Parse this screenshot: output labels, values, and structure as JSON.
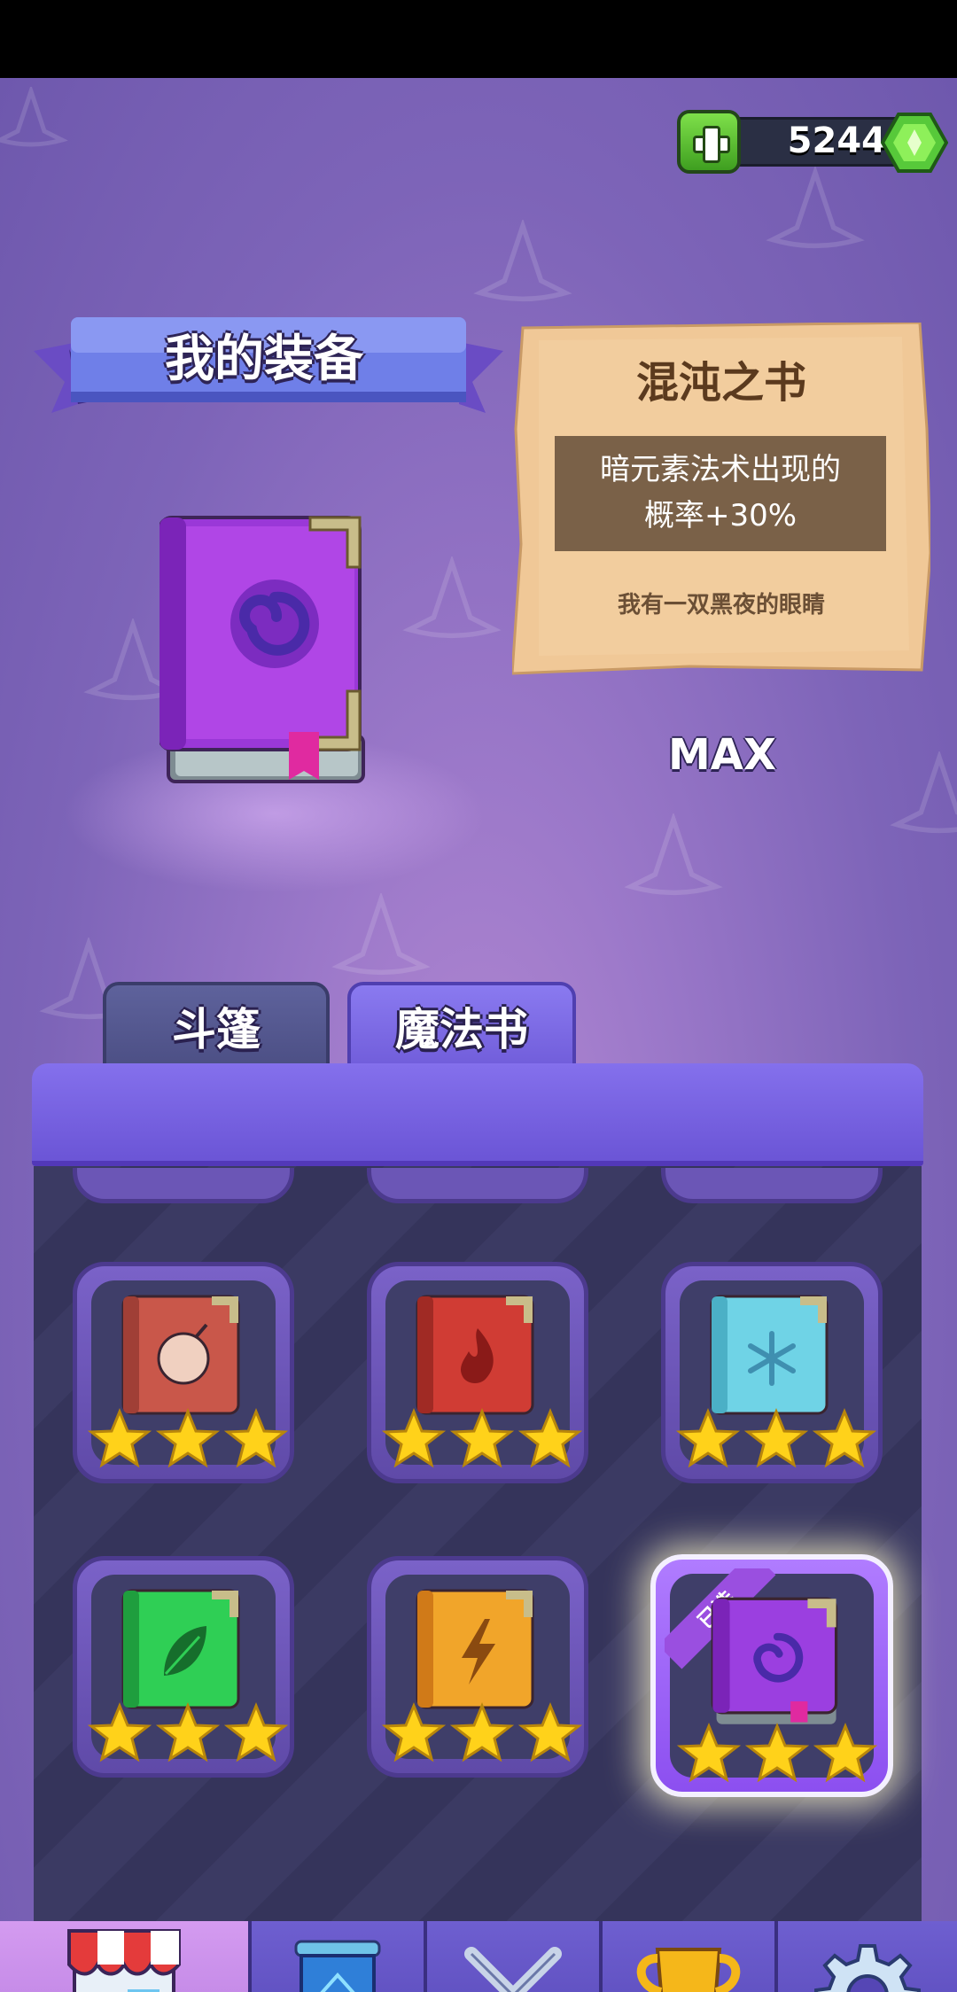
{
  "currency": {
    "amount": "5244",
    "add_icon": "plus-icon",
    "gem_icon": "green-gem-icon"
  },
  "header": {
    "title": "我的装备"
  },
  "item_detail": {
    "name": "混沌之书",
    "description_line1": "暗元素法术出现的",
    "description_line2": "概率+30%",
    "flavor": "我有一双黑夜的眼睛",
    "level_label": "MAX"
  },
  "tabs": [
    {
      "label": "斗篷",
      "active": false
    },
    {
      "label": "魔法书",
      "active": true
    }
  ],
  "books": [
    {
      "name": "bomb-book",
      "color": "#c9574a",
      "icon": "bomb-icon",
      "stars": 3,
      "selected": false
    },
    {
      "name": "fire-book",
      "color": "#d03c34",
      "icon": "flame-icon",
      "stars": 3,
      "selected": false
    },
    {
      "name": "ice-book",
      "color": "#6fd3e6",
      "icon": "snowflake-icon",
      "stars": 3,
      "selected": false
    },
    {
      "name": "nature-book",
      "color": "#2fcf55",
      "icon": "leaf-icon",
      "stars": 3,
      "selected": false
    },
    {
      "name": "lightning-book",
      "color": "#f1a52a",
      "icon": "lightning-icon",
      "stars": 3,
      "selected": false
    },
    {
      "name": "chaos-book",
      "color": "#9b3fe0",
      "icon": "swirl-icon",
      "stars": 3,
      "selected": true,
      "badge": "已选"
    }
  ],
  "nav": [
    {
      "icon": "shop-icon",
      "active": true
    },
    {
      "icon": "shield-emblem-icon",
      "active": false
    },
    {
      "icon": "crossed-swords-icon",
      "active": false
    },
    {
      "icon": "trophy-icon",
      "active": false
    },
    {
      "icon": "gear-icon",
      "active": false
    }
  ]
}
